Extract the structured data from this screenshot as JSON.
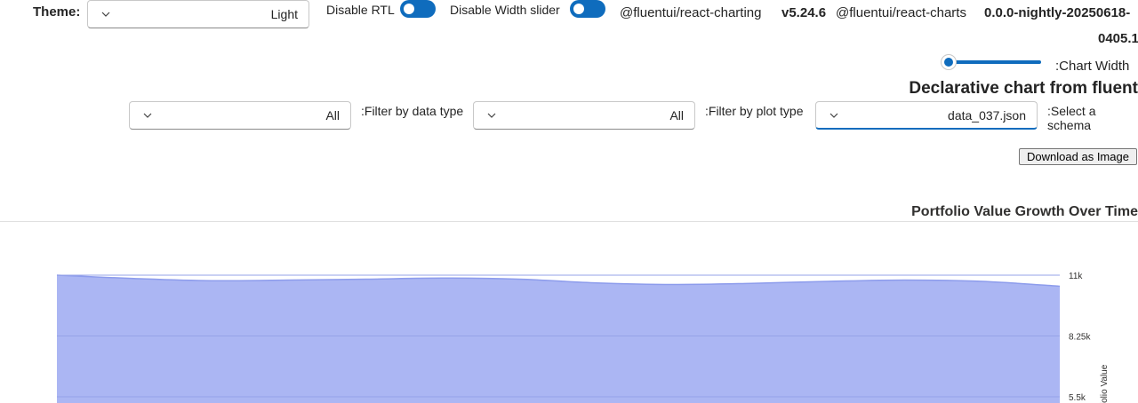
{
  "header": {
    "theme_label": "Theme:",
    "theme_value": "Light",
    "disable_rtl_label": "Disable RTL",
    "disable_width_label": "Disable Width slider",
    "pkg_charting_name": "@fluentui/react-charting",
    "pkg_charting_version": "v5.24.6",
    "pkg_charts_name": "@fluentui/react-charts",
    "pkg_charts_version_line1": "0.0.0-nightly-20250618-",
    "pkg_charts_version_line2": "0405.1",
    "chart_width_label": ":Chart Width",
    "chart_width_fraction": 0.0
  },
  "page_heading": "Declarative chart from fluent",
  "filters": {
    "data_type_label": ":Filter by data type",
    "data_type_value": "All",
    "plot_type_label": ":Filter by plot type",
    "plot_type_value": "All",
    "schema_label": ":Select a schema",
    "schema_value": "data_037.json"
  },
  "download_button": "Download as Image",
  "colors": {
    "accent": "#0f6cbd",
    "area_fill": "#a6b2f2",
    "area_line": "#8d9cec"
  },
  "chart_data": {
    "type": "area",
    "title": "Portfolio Value Growth Over Time",
    "ylabel": "Portfolio Value",
    "y_ticks": [
      "11k",
      "8.25k",
      "5.5k"
    ],
    "y_tick_values": [
      11000,
      8250,
      5500
    ],
    "ylim": [
      5500,
      11000
    ],
    "y_axis_side": "right",
    "grid": true,
    "series": [
      {
        "values": [
          11000,
          10850,
          10750,
          10780,
          10820,
          10870,
          10820,
          10650,
          10580,
          10630,
          10720,
          10780,
          10720,
          10500
        ]
      }
    ]
  }
}
